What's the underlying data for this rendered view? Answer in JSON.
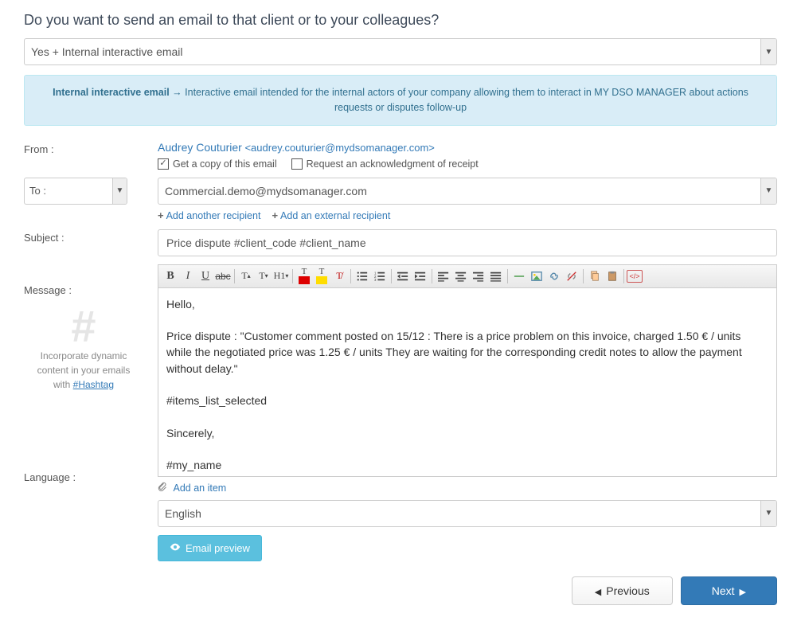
{
  "question_title": "Do you want to send an email to that client or to your colleagues?",
  "email_type": {
    "selected": "Yes + Internal interactive email"
  },
  "callout": {
    "strong": "Internal interactive email",
    "arrow": "→",
    "text": "Interactive email intended for the internal actors of your company allowing them to interact in MY DSO MANAGER about actions requests or disputes follow-up"
  },
  "labels": {
    "from": "From :",
    "to": "To :",
    "subject": "Subject :",
    "message": "Message :",
    "language": "Language :"
  },
  "from": {
    "name": "Audrey Couturier",
    "email": "<audrey.couturier@mydsomanager.com>",
    "copy_label": "Get a copy of this email",
    "ack_label": "Request an acknowledgment of receipt",
    "copy_checked": true,
    "ack_checked": false
  },
  "to": {
    "value": "Commercial.demo@mydsomanager.com"
  },
  "recipient_links": {
    "add_another": "Add another recipient",
    "add_external": "Add an external recipient"
  },
  "subject": {
    "value": "Price dispute #client_code #client_name"
  },
  "hashtag_hint": {
    "line1": "Incorporate dynamic",
    "line2": "content in your emails",
    "line3_prefix": "with ",
    "line3_link": "#Hashtag"
  },
  "message_body": "Hello,\n\nPrice dispute : \"Customer comment posted on 15/12 : There is a price problem on this invoice, charged 1.50 € / units while the negotiated price was 1.25 € / units They are waiting for the corresponding credit notes to allow the payment without delay.\"\n\n#items_list_selected\n\nSincerely,\n\n#my_name\n#my_phone\n#my_email",
  "attach": {
    "label": "Add an item"
  },
  "language": {
    "selected": "English"
  },
  "buttons": {
    "preview": "Email preview",
    "previous": "Previous",
    "next": "Next"
  },
  "toolbar_icons": [
    "bold-icon",
    "italic-icon",
    "underline-icon",
    "strike-icon",
    "font-size-up-icon",
    "font-size-down-icon",
    "heading-icon",
    "text-color-icon",
    "highlight-icon",
    "remove-format-icon",
    "unordered-list-icon",
    "ordered-list-icon",
    "outdent-icon",
    "indent-icon",
    "align-left-icon",
    "align-center-icon",
    "align-right-icon",
    "align-justify-icon",
    "hr-icon",
    "image-icon",
    "link-icon",
    "unlink-icon",
    "copy-icon",
    "paste-icon",
    "source-icon"
  ]
}
